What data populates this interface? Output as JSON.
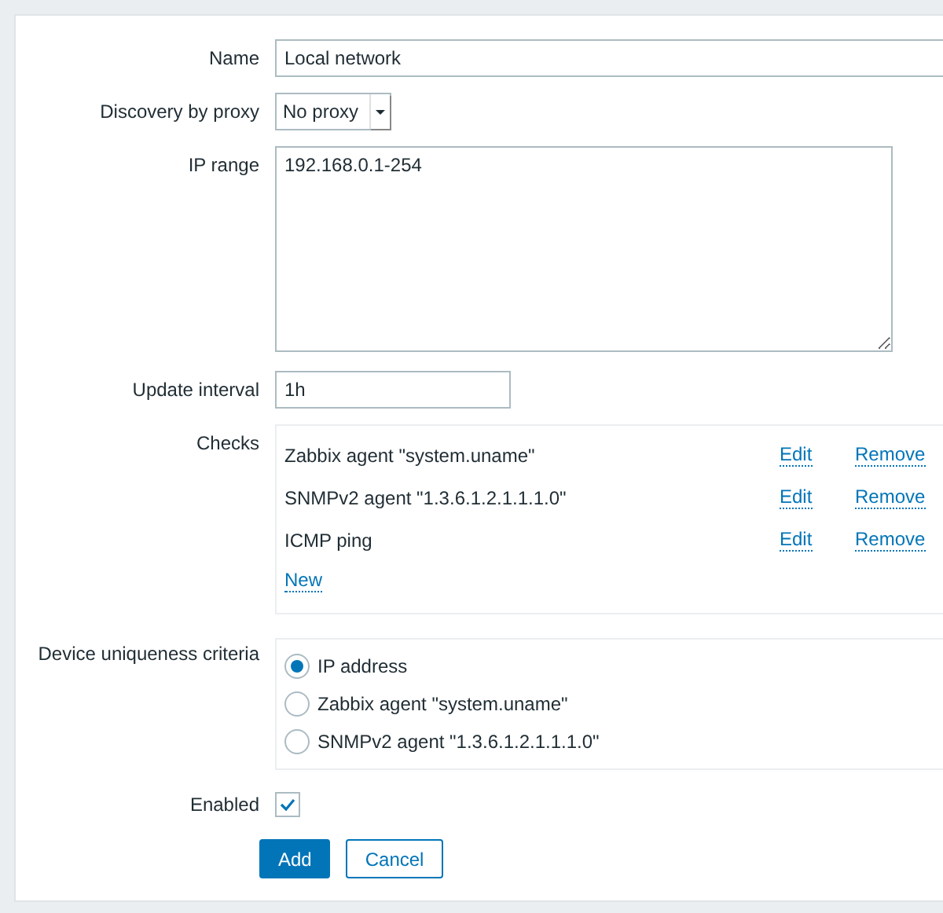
{
  "form": {
    "name": {
      "label": "Name",
      "value": "Local network"
    },
    "proxy": {
      "label": "Discovery by proxy",
      "value": "No proxy"
    },
    "ip_range": {
      "label": "IP range",
      "value": "192.168.0.1-254"
    },
    "update_interval": {
      "label": "Update interval",
      "value": "1h"
    },
    "checks": {
      "label": "Checks",
      "items": [
        {
          "name": "Zabbix agent \"system.uname\"",
          "edit": "Edit",
          "remove": "Remove"
        },
        {
          "name": "SNMPv2 agent \"1.3.6.1.2.1.1.1.0\"",
          "edit": "Edit",
          "remove": "Remove"
        },
        {
          "name": "ICMP ping",
          "edit": "Edit",
          "remove": "Remove"
        }
      ],
      "new": "New"
    },
    "uniqueness": {
      "label": "Device uniqueness criteria",
      "options": [
        {
          "label": "IP address",
          "selected": true
        },
        {
          "label": "Zabbix agent \"system.uname\"",
          "selected": false
        },
        {
          "label": "SNMPv2 agent \"1.3.6.1.2.1.1.1.0\"",
          "selected": false
        }
      ]
    },
    "enabled": {
      "label": "Enabled",
      "checked": true
    },
    "buttons": [
      {
        "label": "Add",
        "kind": "primary"
      },
      {
        "label": "Cancel",
        "kind": "secondary"
      }
    ]
  }
}
